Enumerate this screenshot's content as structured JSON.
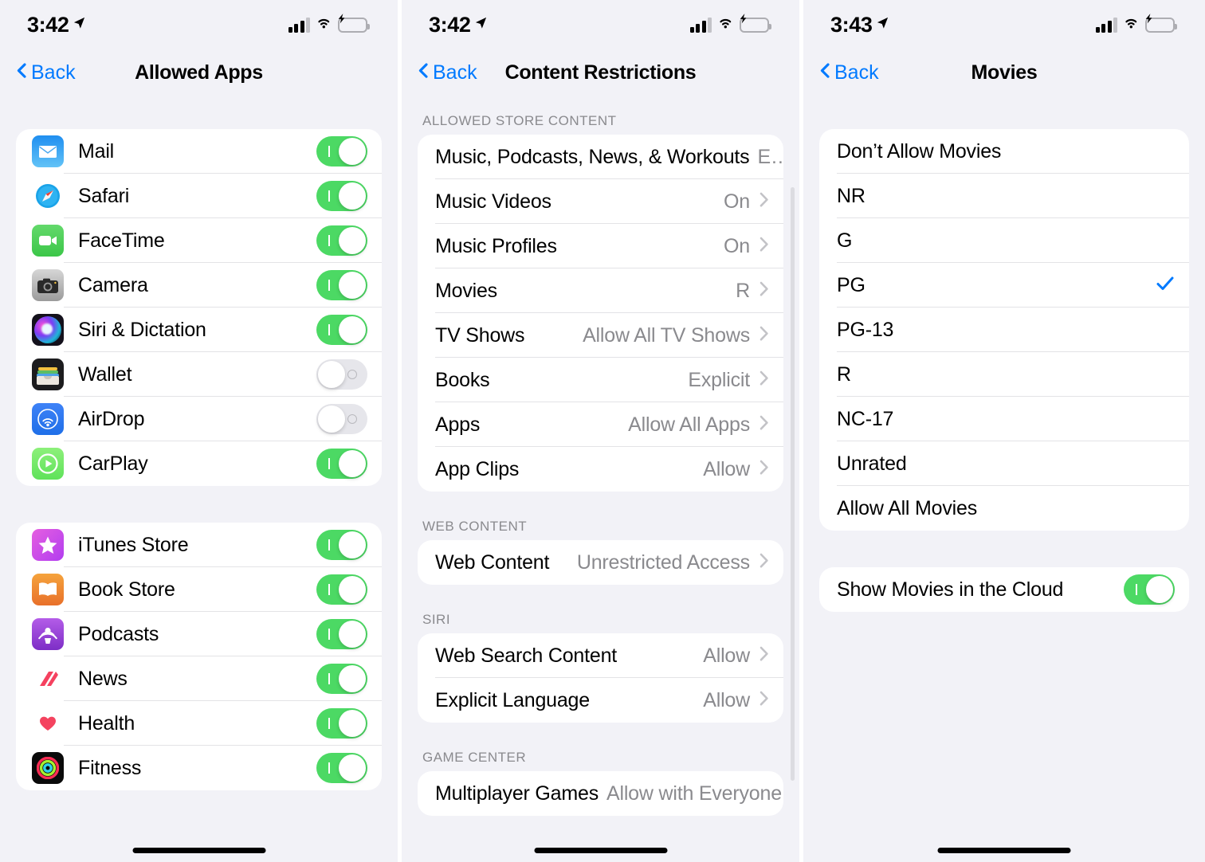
{
  "panels": [
    {
      "status": {
        "time": "3:42",
        "location_icon": "location-arrow-icon",
        "cellular": "cellular-bars-icon",
        "wifi": "wifi-icon",
        "battery": "battery-charging-icon"
      },
      "nav": {
        "back_label": "Back",
        "title": "Allowed Apps"
      },
      "sections": [
        {
          "header": "",
          "rows": [
            {
              "icon": "mail-app-icon",
              "label": "Mail",
              "toggle": "on"
            },
            {
              "icon": "safari-app-icon",
              "label": "Safari",
              "toggle": "on"
            },
            {
              "icon": "facetime-app-icon",
              "label": "FaceTime",
              "toggle": "on"
            },
            {
              "icon": "camera-app-icon",
              "label": "Camera",
              "toggle": "on"
            },
            {
              "icon": "siri-app-icon",
              "label": "Siri & Dictation",
              "toggle": "on"
            },
            {
              "icon": "wallet-app-icon",
              "label": "Wallet",
              "toggle": "off"
            },
            {
              "icon": "airdrop-app-icon",
              "label": "AirDrop",
              "toggle": "off"
            },
            {
              "icon": "carplay-app-icon",
              "label": "CarPlay",
              "toggle": "on"
            }
          ]
        },
        {
          "header": "",
          "rows": [
            {
              "icon": "itunes-store-app-icon",
              "label": "iTunes Store",
              "toggle": "on"
            },
            {
              "icon": "book-store-app-icon",
              "label": "Book Store",
              "toggle": "on"
            },
            {
              "icon": "podcasts-app-icon",
              "label": "Podcasts",
              "toggle": "on"
            },
            {
              "icon": "news-app-icon",
              "label": "News",
              "toggle": "on"
            },
            {
              "icon": "health-app-icon",
              "label": "Health",
              "toggle": "on"
            },
            {
              "icon": "fitness-app-icon",
              "label": "Fitness",
              "toggle": "on"
            }
          ]
        }
      ]
    },
    {
      "status": {
        "time": "3:42",
        "location_icon": "location-arrow-icon",
        "cellular": "cellular-bars-icon",
        "wifi": "wifi-icon",
        "battery": "battery-charging-icon"
      },
      "nav": {
        "back_label": "Back",
        "title": "Content Restrictions"
      },
      "sections": [
        {
          "header": "ALLOWED STORE CONTENT",
          "rows": [
            {
              "label": "Music, Podcasts, News, & Workouts",
              "value": "E…"
            },
            {
              "label": "Music Videos",
              "value": "On"
            },
            {
              "label": "Music Profiles",
              "value": "On"
            },
            {
              "label": "Movies",
              "value": "R"
            },
            {
              "label": "TV Shows",
              "value": "Allow All TV Shows"
            },
            {
              "label": "Books",
              "value": "Explicit"
            },
            {
              "label": "Apps",
              "value": "Allow All Apps"
            },
            {
              "label": "App Clips",
              "value": "Allow"
            }
          ]
        },
        {
          "header": "WEB CONTENT",
          "rows": [
            {
              "label": "Web Content",
              "value": "Unrestricted Access"
            }
          ]
        },
        {
          "header": "SIRI",
          "rows": [
            {
              "label": "Web Search Content",
              "value": "Allow"
            },
            {
              "label": "Explicit Language",
              "value": "Allow"
            }
          ]
        },
        {
          "header": "GAME CENTER",
          "rows": [
            {
              "label": "Multiplayer Games",
              "value": "Allow with Everyone"
            }
          ]
        }
      ]
    },
    {
      "status": {
        "time": "3:43",
        "location_icon": "location-arrow-icon",
        "cellular": "cellular-bars-icon",
        "wifi": "wifi-icon",
        "battery": "battery-charging-icon"
      },
      "nav": {
        "back_label": "Back",
        "title": "Movies"
      },
      "sections": [
        {
          "header": "",
          "rows": [
            {
              "label": "Don’t Allow Movies",
              "checked": false
            },
            {
              "label": "NR",
              "checked": false
            },
            {
              "label": "G",
              "checked": false
            },
            {
              "label": "PG",
              "checked": true
            },
            {
              "label": "PG-13",
              "checked": false
            },
            {
              "label": "R",
              "checked": false
            },
            {
              "label": "NC-17",
              "checked": false
            },
            {
              "label": "Unrated",
              "checked": false
            },
            {
              "label": "Allow All Movies",
              "checked": false
            }
          ]
        },
        {
          "header": "",
          "rows": [
            {
              "label": "Show Movies in the Cloud",
              "toggle": "on"
            }
          ]
        }
      ]
    }
  ],
  "colors": {
    "accent": "#007aff",
    "toggle_on": "#4cd964",
    "toggle_off": "#e6e6eb",
    "background": "#f2f2f7",
    "card": "#ffffff",
    "secondary_text": "#8a8a8e",
    "check": "#007aff"
  }
}
